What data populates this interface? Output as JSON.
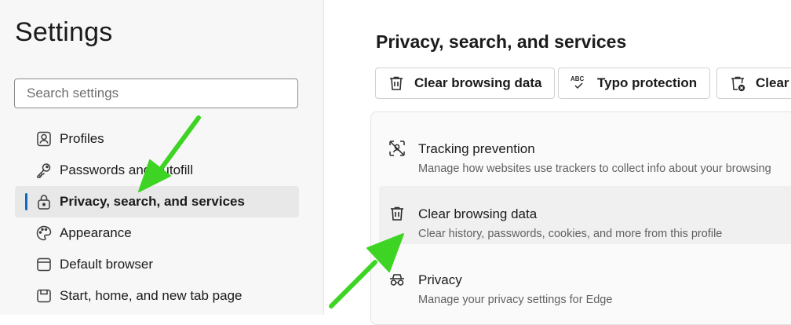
{
  "sidebar": {
    "title": "Settings",
    "search": {
      "placeholder": "Search settings",
      "value": ""
    },
    "items": [
      {
        "label": "Profiles",
        "icon": "profile-icon",
        "active": false
      },
      {
        "label": "Passwords and autofill",
        "icon": "key-icon",
        "active": false
      },
      {
        "label": "Privacy, search, and services",
        "icon": "lock-icon",
        "active": true
      },
      {
        "label": "Appearance",
        "icon": "palette-icon",
        "active": false
      },
      {
        "label": "Default browser",
        "icon": "browser-window-icon",
        "active": false
      },
      {
        "label": "Start, home, and new tab page",
        "icon": "home-page-icon",
        "active": false
      }
    ]
  },
  "main": {
    "title": "Privacy, search, and services",
    "quick_actions": [
      {
        "label": "Clear browsing data",
        "icon": "trash-icon"
      },
      {
        "label": "Typo protection",
        "icon": "spellcheck-icon"
      },
      {
        "label": "Clear",
        "icon": "trash-x-icon"
      }
    ],
    "rows": [
      {
        "title": "Tracking prevention",
        "description": "Manage how websites use trackers to collect info about your browsing",
        "icon": "tracking-prevention-icon"
      },
      {
        "title": "Clear browsing data",
        "description": "Clear history, passwords, cookies, and more from this profile",
        "icon": "trash-icon"
      },
      {
        "title": "Privacy",
        "description": "Manage your privacy settings for Edge",
        "icon": "incognito-glasses-icon"
      }
    ]
  },
  "colors": {
    "accent": "#0f6cbd",
    "annotation_arrow": "#3ed423"
  }
}
